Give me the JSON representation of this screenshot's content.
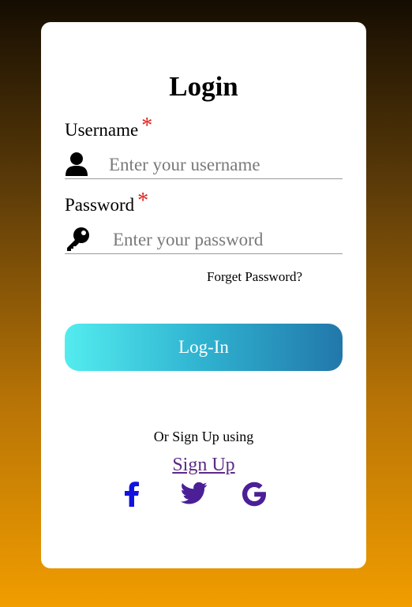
{
  "form": {
    "title": "Login",
    "required_mark": "*",
    "username": {
      "label": "Username",
      "placeholder": "Enter your username",
      "value": ""
    },
    "password": {
      "label": "Password",
      "placeholder": "Enter your password",
      "value": ""
    },
    "forgot_label": "Forget Password?",
    "login_label": "Log-In",
    "or_text": "Or Sign Up using",
    "signup_label": "Sign Up"
  },
  "social": [
    {
      "name": "facebook-icon",
      "color": "#1212e0"
    },
    {
      "name": "twitter-icon",
      "color": "#4b1f96"
    },
    {
      "name": "google-icon",
      "color": "#4b1f96"
    }
  ],
  "colors": {
    "card_bg": "#ffffff",
    "required": "#e0201a",
    "button_start": "#53ecef",
    "button_end": "#2277aa",
    "link": "#5b2a86"
  }
}
